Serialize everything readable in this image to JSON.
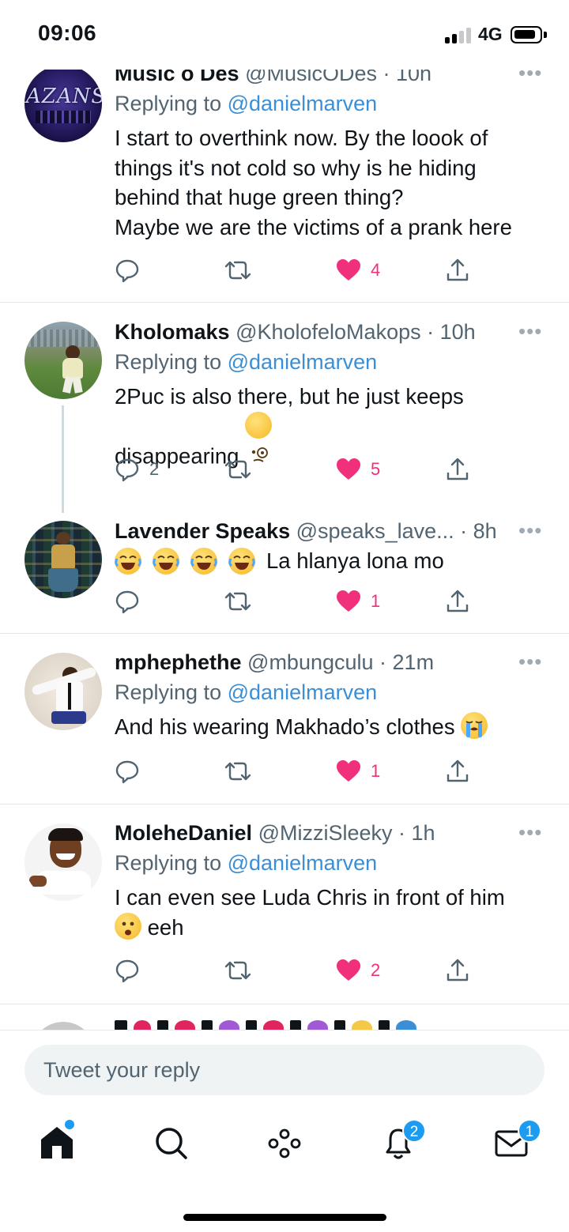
{
  "status_bar": {
    "time": "09:06",
    "network": "4G"
  },
  "tweets": [
    {
      "name": "Music o Des",
      "handle": "@MusicODes",
      "time": "· 10h",
      "reply_prefix": "Replying to",
      "reply_to": "@danielmarven",
      "text": "I start to overthink now. By the loook of\nthings it's not cold so why is he hiding\nbehind that huge green thing?\nMaybe we are the victims of a prank here",
      "replies": "",
      "likes": "4",
      "avatar_text": "AZANS"
    },
    {
      "name": "Kholomaks",
      "handle": "@KholofeloMakops",
      "time": "· 10h",
      "reply_prefix": "Replying to",
      "reply_to": "@danielmarven",
      "text": "2Puc is also there, but he just keeps\ndisappearing",
      "replies": "2",
      "likes": "5"
    },
    {
      "name": "Lavender Speaks",
      "handle": "@speaks_lave...",
      "time": "· 8h",
      "text": "La hlanya lona mo",
      "replies": "",
      "likes": "1"
    },
    {
      "name": "mphephethe",
      "handle": "@mbungculu",
      "time": "· 21m",
      "reply_prefix": "Replying to",
      "reply_to": "@danielmarven",
      "text": "And his wearing Makhado’s clothes",
      "replies": "",
      "likes": "1"
    },
    {
      "name": "MoleheDaniel",
      "handle": "@MizziSleeky",
      "time": "· 1h",
      "reply_prefix": "Replying to",
      "reply_to": "@danielmarven",
      "text_line1": "I can even see Luda Chris in front of him",
      "text_line2": "eeh",
      "replies": "",
      "likes": "2"
    }
  ],
  "composer": {
    "placeholder": "Tweet your reply"
  },
  "tabbar": {
    "notifications_badge": "2",
    "messages_badge": "1"
  },
  "colors": {
    "accent": "#1d9bf0",
    "like": "#f0307a",
    "secondary_text": "#536471"
  },
  "icons": [
    "reply-icon",
    "retweet-icon",
    "heart-icon",
    "share-icon",
    "more-icon",
    "home-icon",
    "search-icon",
    "spaces-icon",
    "bell-icon",
    "mail-icon"
  ]
}
